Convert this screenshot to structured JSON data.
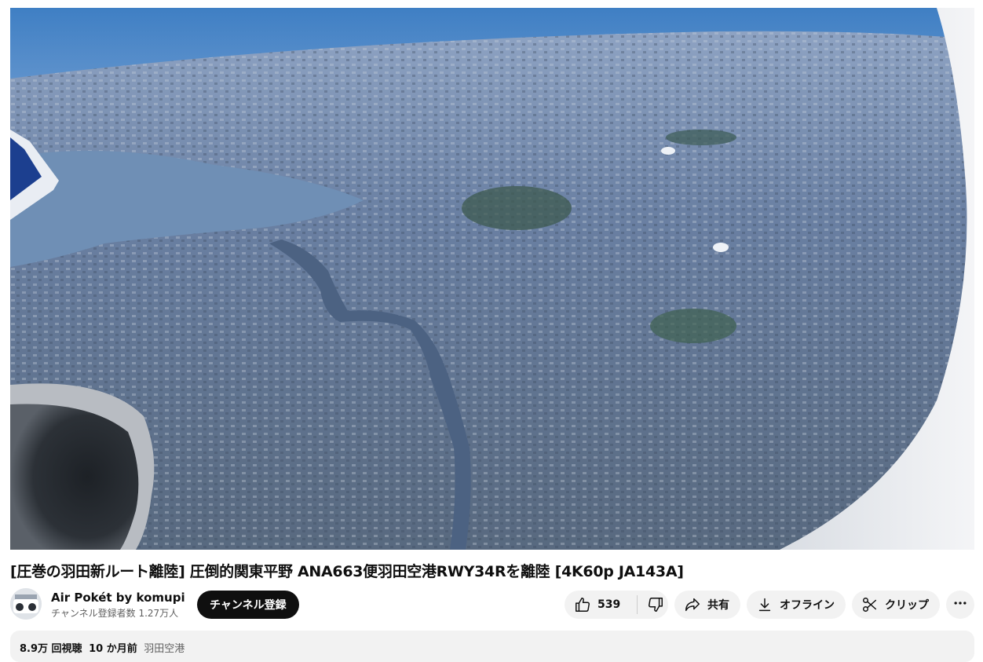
{
  "video": {
    "title": "[圧巻の羽田新ルート離陸] 圧倒的関東平野 ANA663便羽田空港RWY34Rを離陸 [4K60p JA143A]"
  },
  "channel": {
    "name": "Air Pokét by komupi",
    "subscribers": "チャンネル登録者数 1.27万人",
    "subscribe_label": "チャンネル登録"
  },
  "actions": {
    "like_count": "539",
    "share_label": "共有",
    "offline_label": "オフライン",
    "clip_label": "クリップ",
    "more_icon": "more-horizontal-icon"
  },
  "description": {
    "views": "8.9万 回視聴",
    "age": "10 か月前",
    "location": "羽田空港"
  },
  "colors": {
    "sky": "#bcd0ea",
    "city": "#5f7597",
    "water": "#6f8fb5",
    "button_bg": "#f2f2f2",
    "subscribe_bg": "#0f0f0f"
  }
}
